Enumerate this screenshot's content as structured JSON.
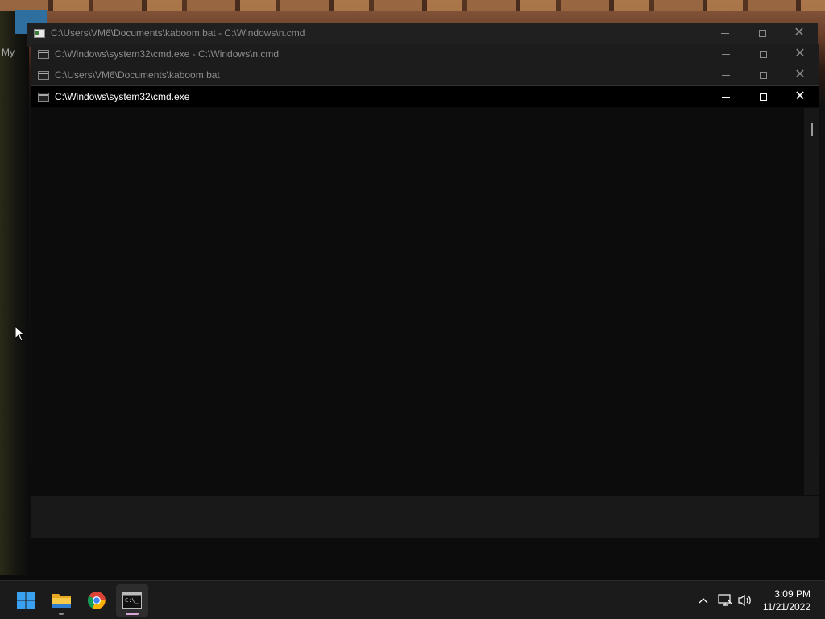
{
  "desktop": {
    "partial_label": "My"
  },
  "windows": [
    {
      "title": "C:\\Users\\VM6\\Documents\\kaboom.bat - C:\\Windows\\n.cmd",
      "state": "inactive",
      "icon": "batch-file-icon"
    },
    {
      "title": "C:\\Windows\\system32\\cmd.exe - C:\\Windows\\n.cmd",
      "state": "inactive",
      "icon": "cmd-icon"
    },
    {
      "title": "C:\\Users\\VM6\\Documents\\kaboom.bat",
      "state": "inactive",
      "icon": "cmd-icon"
    },
    {
      "title": "C:\\Windows\\system32\\cmd.exe",
      "state": "active",
      "icon": "cmd-icon"
    }
  ],
  "taskbar": {
    "apps": [
      {
        "name": "Start",
        "icon": "windows-logo-icon"
      },
      {
        "name": "File Explorer",
        "icon": "folder-icon"
      },
      {
        "name": "Google Chrome",
        "icon": "chrome-icon"
      },
      {
        "name": "Command Prompt",
        "icon": "cmd-icon"
      }
    ],
    "tray": {
      "chevron": "^",
      "network_icon": "network-icon",
      "volume_icon": "volume-icon"
    },
    "clock": {
      "time": "3:09 PM",
      "date": "11/21/2022"
    }
  },
  "colors": {
    "console_bg": "#0c0c0c",
    "taskbar_bg": "#1b1b1b",
    "windows_blue": "#0078d4"
  }
}
